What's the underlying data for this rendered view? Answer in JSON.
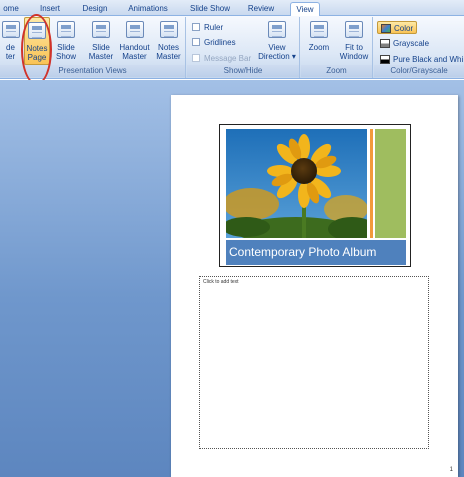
{
  "tabs": [
    "ome",
    "Insert",
    "Design",
    "Animations",
    "Slide Show",
    "Review",
    "View"
  ],
  "active_tab": "View",
  "ribbon": {
    "presentation_views": {
      "label": "Presentation Views",
      "buttons": [
        {
          "label": "de\nter",
          "icon": "normal-view-icon"
        },
        {
          "label": "Notes\nPage",
          "icon": "notes-page-icon"
        },
        {
          "label": "Slide\nShow",
          "icon": "slide-show-icon"
        },
        {
          "label": "Slide\nMaster",
          "icon": "slide-master-icon"
        },
        {
          "label": "Handout\nMaster",
          "icon": "handout-master-icon"
        },
        {
          "label": "Notes\nMaster",
          "icon": "notes-master-icon"
        }
      ]
    },
    "show_hide": {
      "label": "Show/Hide",
      "checkboxes": [
        {
          "label": "Ruler",
          "enabled": true
        },
        {
          "label": "Gridlines",
          "enabled": true
        },
        {
          "label": "Message Bar",
          "enabled": false
        }
      ],
      "view_direction": {
        "label": "View\nDirection ▾",
        "icon": "view-direction-icon"
      }
    },
    "zoom": {
      "label": "Zoom",
      "buttons": [
        {
          "label": "Zoom",
          "icon": "zoom-magnifier-icon"
        },
        {
          "label": "Fit to\nWindow",
          "icon": "fit-to-window-icon"
        }
      ]
    },
    "color_grayscale": {
      "label": "Color/Grayscale",
      "options": [
        {
          "label": "Color",
          "selected": true,
          "swatch": "#e07b2a"
        },
        {
          "label": "Grayscale",
          "selected": false,
          "swatch": "#808080"
        },
        {
          "label": "Pure Black and White",
          "selected": false,
          "swatch": "#000000"
        }
      ]
    }
  },
  "notes_page": {
    "slide_title": "Contemporary Photo Album",
    "notes_placeholder": "Click to add text",
    "page_number": "1"
  },
  "colors": {
    "accent_blue": "#4f81bd",
    "panel_green": "#9fbd5f",
    "stripe_orange": "#f29a3b",
    "annotation_red": "#d0332b",
    "highlight_gold": "#f9c356"
  }
}
